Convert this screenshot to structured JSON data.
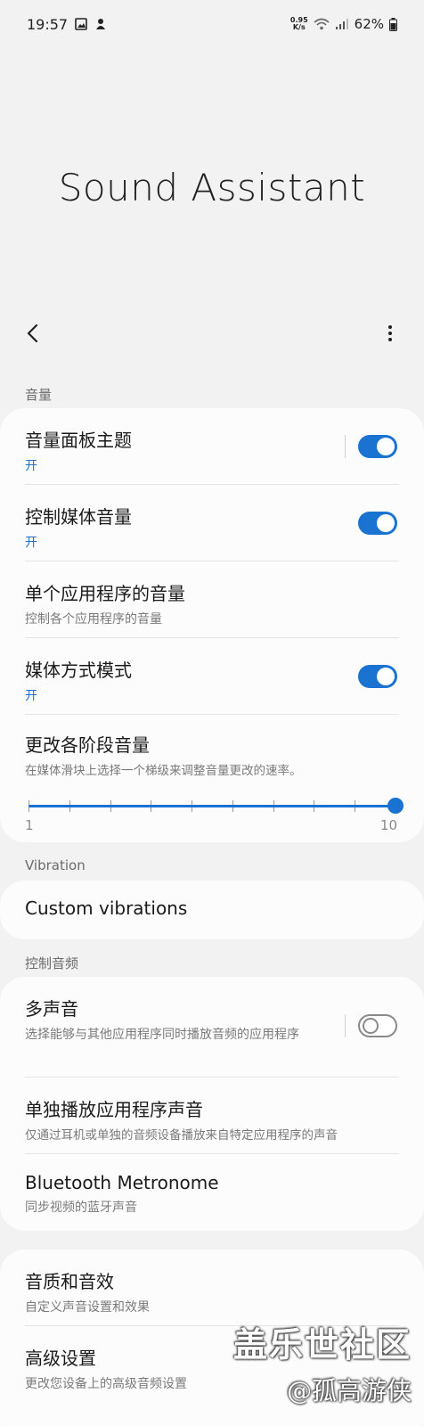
{
  "status": {
    "time": "19:57",
    "netspeed_value": "0.95",
    "netspeed_unit": "K/s",
    "battery": "62%"
  },
  "page_title": "Sound Assistant",
  "sections": {
    "volume_header": "音量",
    "vibration_header": "Vibration",
    "control_audio_header": "控制音频"
  },
  "volume": {
    "panel_theme": {
      "title": "音量面板主题",
      "state": "开",
      "toggle_on": true
    },
    "control_media": {
      "title": "控制媒体音量",
      "state": "开",
      "toggle_on": true
    },
    "per_app": {
      "title": "单个应用程序的音量",
      "subtitle": "控制各个应用程序的音量"
    },
    "media_mode": {
      "title": "媒体方式模式",
      "state": "开",
      "toggle_on": true
    },
    "step_volume": {
      "title": "更改各阶段音量",
      "subtitle": "在媒体滑块上选择一个梯级来调整音量更改的速率。",
      "min_label": "1",
      "max_label": "10",
      "value": 10,
      "min": 1,
      "max": 10
    }
  },
  "vibration": {
    "custom": {
      "title": "Custom vibrations"
    }
  },
  "control_audio": {
    "multi_sound": {
      "title": "多声音",
      "subtitle": "选择能够与其他应用程序同时播放音频的应用程序",
      "toggle_on": false
    },
    "separate_app": {
      "title": "单独播放应用程序声音",
      "subtitle": "仅通过耳机或单独的音频设备播放来自特定应用程序的声音"
    },
    "bt_metronome": {
      "title": "Bluetooth Metronome",
      "subtitle": "同步视频的蓝牙声音"
    }
  },
  "more": {
    "sound_quality": {
      "title": "音质和音效",
      "subtitle": "自定义声音设置和效果"
    },
    "advanced": {
      "title": "高级设置",
      "subtitle": "更改您设备上的高级音频设置"
    }
  },
  "watermark": {
    "line1": "盖乐世社区",
    "line2": "@孤高游侠"
  },
  "colors": {
    "accent": "#1a73d1",
    "background": "#f2f2f2",
    "card": "#fcfcfc"
  }
}
